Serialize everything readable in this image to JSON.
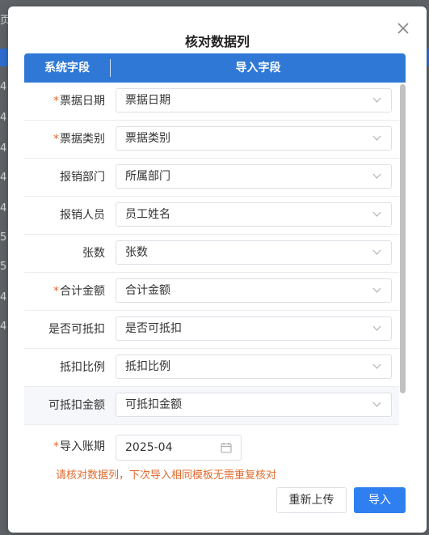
{
  "background": {
    "fragments": [
      "页",
      "4",
      "4",
      "4",
      "4",
      "4",
      "5",
      "5",
      "4",
      "4"
    ]
  },
  "dialog": {
    "title": "核对数据列",
    "close_icon": "close-icon"
  },
  "table": {
    "header_system": "系统字段",
    "header_import": "导入字段",
    "rows": [
      {
        "label": "票据日期",
        "required": true,
        "value": "票据日期"
      },
      {
        "label": "票据类别",
        "required": true,
        "value": "票据类别"
      },
      {
        "label": "报销部门",
        "required": false,
        "value": "所属部门"
      },
      {
        "label": "报销人员",
        "required": false,
        "value": "员工姓名"
      },
      {
        "label": "张数",
        "required": false,
        "value": "张数"
      },
      {
        "label": "合计金额",
        "required": true,
        "value": "合计金额"
      },
      {
        "label": "是否可抵扣",
        "required": false,
        "value": "是否可抵扣"
      },
      {
        "label": "抵扣比例",
        "required": false,
        "value": "抵扣比例"
      },
      {
        "label": "可抵扣金额",
        "required": false,
        "value": "可抵扣金额"
      }
    ]
  },
  "period": {
    "label": "导入账期",
    "required": true,
    "value": "2025-04",
    "icon": "calendar-icon"
  },
  "tip": "请核对数据列，下次导入相同模板无需重复核对",
  "buttons": {
    "reupload": "重新上传",
    "import": "导入"
  },
  "colors": {
    "header": "#2f78d6",
    "primary": "#2f7ff0",
    "required": "#e06a2c"
  }
}
